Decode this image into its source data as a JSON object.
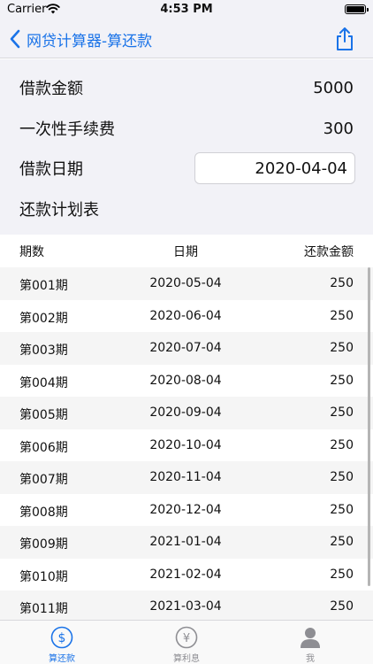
{
  "status_bar": {
    "carrier": "Carrier",
    "time": "4:53 PM"
  },
  "nav": {
    "title": "网贷计算器-算还款"
  },
  "form": {
    "amount_label": "借款金额",
    "amount_value": "5000",
    "fee_label": "一次性手续费",
    "fee_value": "300",
    "date_label": "借款日期",
    "date_value": "2020-04-04",
    "schedule_title": "还款计划表"
  },
  "table": {
    "headers": [
      "期数",
      "日期",
      "还款金额"
    ],
    "rows": [
      [
        "第001期",
        "2020-05-04",
        "250"
      ],
      [
        "第002期",
        "2020-06-04",
        "250"
      ],
      [
        "第003期",
        "2020-07-04",
        "250"
      ],
      [
        "第004期",
        "2020-08-04",
        "250"
      ],
      [
        "第005期",
        "2020-09-04",
        "250"
      ],
      [
        "第006期",
        "2020-10-04",
        "250"
      ],
      [
        "第007期",
        "2020-11-04",
        "250"
      ],
      [
        "第008期",
        "2020-12-04",
        "250"
      ],
      [
        "第009期",
        "2021-01-04",
        "250"
      ],
      [
        "第010期",
        "2021-02-04",
        "250"
      ],
      [
        "第011期",
        "2021-03-04",
        "250"
      ]
    ]
  },
  "tabs": [
    {
      "label": "算还款",
      "icon": "dollar-circle-icon",
      "active": true
    },
    {
      "label": "算利息",
      "icon": "yen-circle-icon",
      "active": false
    },
    {
      "label": "我",
      "icon": "person-icon",
      "active": false
    }
  ],
  "colors": {
    "accent": "#1a73e8",
    "inactive": "#8e8e93",
    "header_bg": "#f2f2f7"
  }
}
